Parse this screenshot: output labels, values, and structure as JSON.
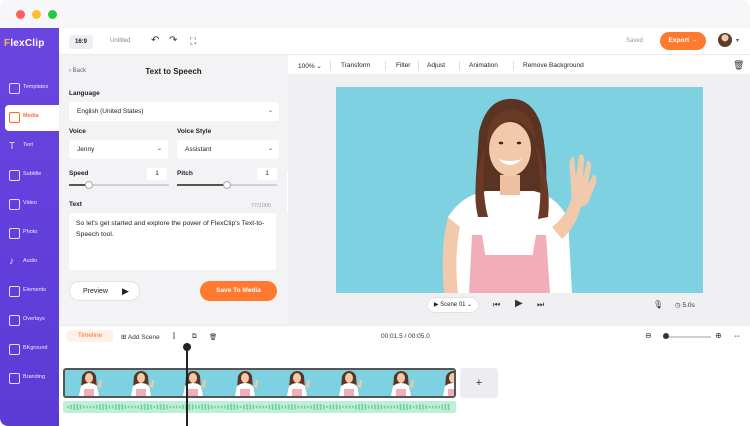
{
  "app": {
    "logo_text": "FlexClip",
    "logo_first": "F",
    "logo_rest": "lexClip"
  },
  "sidebar": {
    "items": [
      {
        "label": "Templates",
        "icon": "templates-icon"
      },
      {
        "label": "Media",
        "icon": "media-icon",
        "active": true
      },
      {
        "label": "Text",
        "icon": "text-icon"
      },
      {
        "label": "Subtitle",
        "icon": "subtitle-icon"
      },
      {
        "label": "Video",
        "icon": "video-icon"
      },
      {
        "label": "Photo",
        "icon": "photo-icon"
      },
      {
        "label": "Audio",
        "icon": "audio-icon"
      },
      {
        "label": "Elements",
        "icon": "elements-icon"
      },
      {
        "label": "Overlays",
        "icon": "overlays-icon"
      },
      {
        "label": "BKground",
        "icon": "background-icon"
      },
      {
        "label": "Branding",
        "icon": "branding-icon"
      }
    ]
  },
  "topbar": {
    "ratio": "16:9",
    "title": "Untitled",
    "saved": "Saved",
    "export": "Export →"
  },
  "panel": {
    "back": "Back",
    "title": "Text to Speech",
    "language_label": "Language",
    "language_value": "English (United States)",
    "voice_label": "Voice",
    "voice_value": "Jenny",
    "voice_style_label": "Voice Style",
    "voice_style_value": "Assistant",
    "speed_label": "Speed",
    "speed_value": "1",
    "speed_level": 0.2,
    "pitch_label": "Pitch",
    "pitch_value": "1",
    "pitch_level": 0.5,
    "text_label": "Text",
    "char_count": "77/1000",
    "text_value": "So let's get started and explore the power of FlexClip's Text-to-Speech tool.",
    "preview": "Preview",
    "save": "Save To Media"
  },
  "toolbar": {
    "zoom": "100%",
    "items": [
      "Transform",
      "Filter",
      "Adjust",
      "Animation",
      "Remove Background"
    ]
  },
  "player": {
    "scene": "Scene 01",
    "duration": "5.0s"
  },
  "timeline": {
    "tab": "Timeline",
    "add_scene": "Add Scene",
    "time": "00:01.5 / 00:05.0"
  },
  "colors": {
    "accent": "#ff7a2f",
    "sidebar": "#6a45e0",
    "canvas_bg": "#7dd1e0",
    "audio": "#bff0d6"
  }
}
